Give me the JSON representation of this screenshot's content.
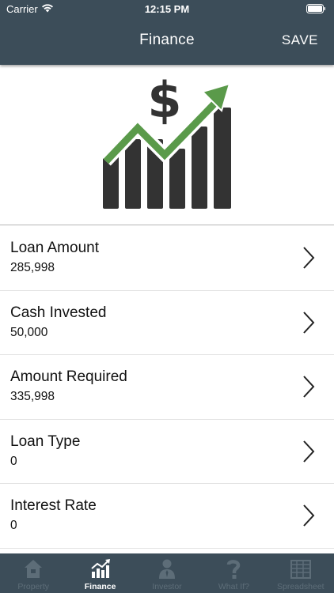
{
  "status_bar": {
    "carrier": "Carrier",
    "time": "12:15 PM"
  },
  "nav": {
    "title": "Finance",
    "save_label": "SAVE"
  },
  "logo": {
    "icon": "finance-growth-chart-dollar-icon",
    "colors": {
      "bars": "#333333",
      "arrow": "#5a9a4a"
    }
  },
  "items": [
    {
      "title": "Loan Amount",
      "value": "285,998"
    },
    {
      "title": "Cash Invested",
      "value": "50,000"
    },
    {
      "title": "Amount Required",
      "value": "335,998"
    },
    {
      "title": "Loan Type",
      "value": "0"
    },
    {
      "title": "Interest Rate",
      "value": "0"
    }
  ],
  "tabs": [
    {
      "label": "Property",
      "icon": "house-icon",
      "active": false
    },
    {
      "label": "Finance",
      "icon": "bar-chart-icon",
      "active": true
    },
    {
      "label": "Investor",
      "icon": "person-icon",
      "active": false
    },
    {
      "label": "What If?",
      "icon": "question-icon",
      "active": false
    },
    {
      "label": "Spreadsheet",
      "icon": "spreadsheet-icon",
      "active": false
    }
  ],
  "colors": {
    "header": "#3c4d59",
    "tab_inactive": "#5d6d78",
    "tab_active": "#ffffff"
  }
}
